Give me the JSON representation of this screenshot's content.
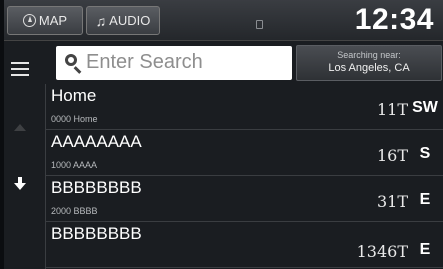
{
  "topbar": {
    "map_label": "MAP",
    "audio_label": "AUDIO",
    "clock": "12:34"
  },
  "search": {
    "placeholder": "Enter Search",
    "near_label": "Searching near:",
    "near_city": "Los Angeles, CA"
  },
  "list": {
    "items": [
      {
        "name": "Home",
        "address": "0000 Home",
        "distance": "11T",
        "direction": "SW"
      },
      {
        "name": "AAAAAAAA",
        "address": "1000 AAAA",
        "distance": "16T",
        "direction": "S"
      },
      {
        "name": "BBBBBBBB",
        "address": "2000 BBBB",
        "distance": "31T",
        "direction": "E"
      },
      {
        "name": "BBBBBBBB",
        "address": "",
        "distance": "1346T",
        "direction": "E"
      }
    ]
  },
  "icons": [
    "compass-icon",
    "music-note-icon",
    "search-icon",
    "menu-icon",
    "scroll-up-icon",
    "scroll-down-icon"
  ],
  "colors": {
    "background": "#1a1d21",
    "search_field": "#ffffff",
    "text": "#ffffff"
  }
}
